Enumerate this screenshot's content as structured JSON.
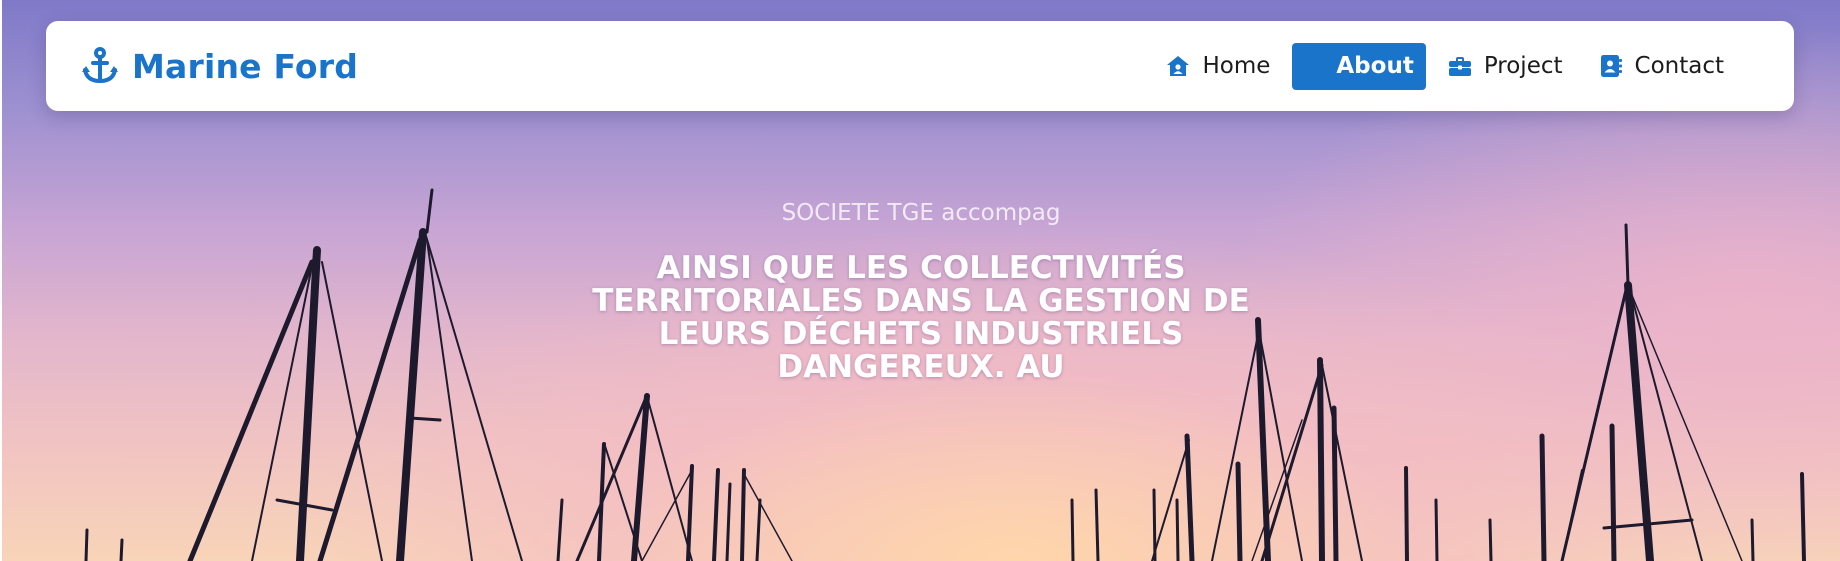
{
  "brand": {
    "name": "Marine Ford",
    "icon": "anchor-icon"
  },
  "nav": {
    "items": [
      {
        "label": "Home",
        "icon": "house-user-icon",
        "active": false
      },
      {
        "label": "About",
        "icon": "",
        "active": true
      },
      {
        "label": "Project",
        "icon": "briefcase-icon",
        "active": false
      },
      {
        "label": "Contact",
        "icon": "address-book-icon",
        "active": false
      }
    ]
  },
  "hero": {
    "eyebrow": "SOCIETE TGE accompag",
    "headline": "AINSI QUE LES COLLECTIVITÉS TERRITORIALES DANS LA GESTION DE LEURS DÉCHETS INDUSTRIELS DANGEREUX. AU",
    "background": "sunset-sky-with-sailboat-masts"
  },
  "colors": {
    "accent": "#1a74c9",
    "navbar_bg": "#ffffff",
    "text_dark": "#1c1c1c",
    "hero_text": "#ffffff"
  }
}
